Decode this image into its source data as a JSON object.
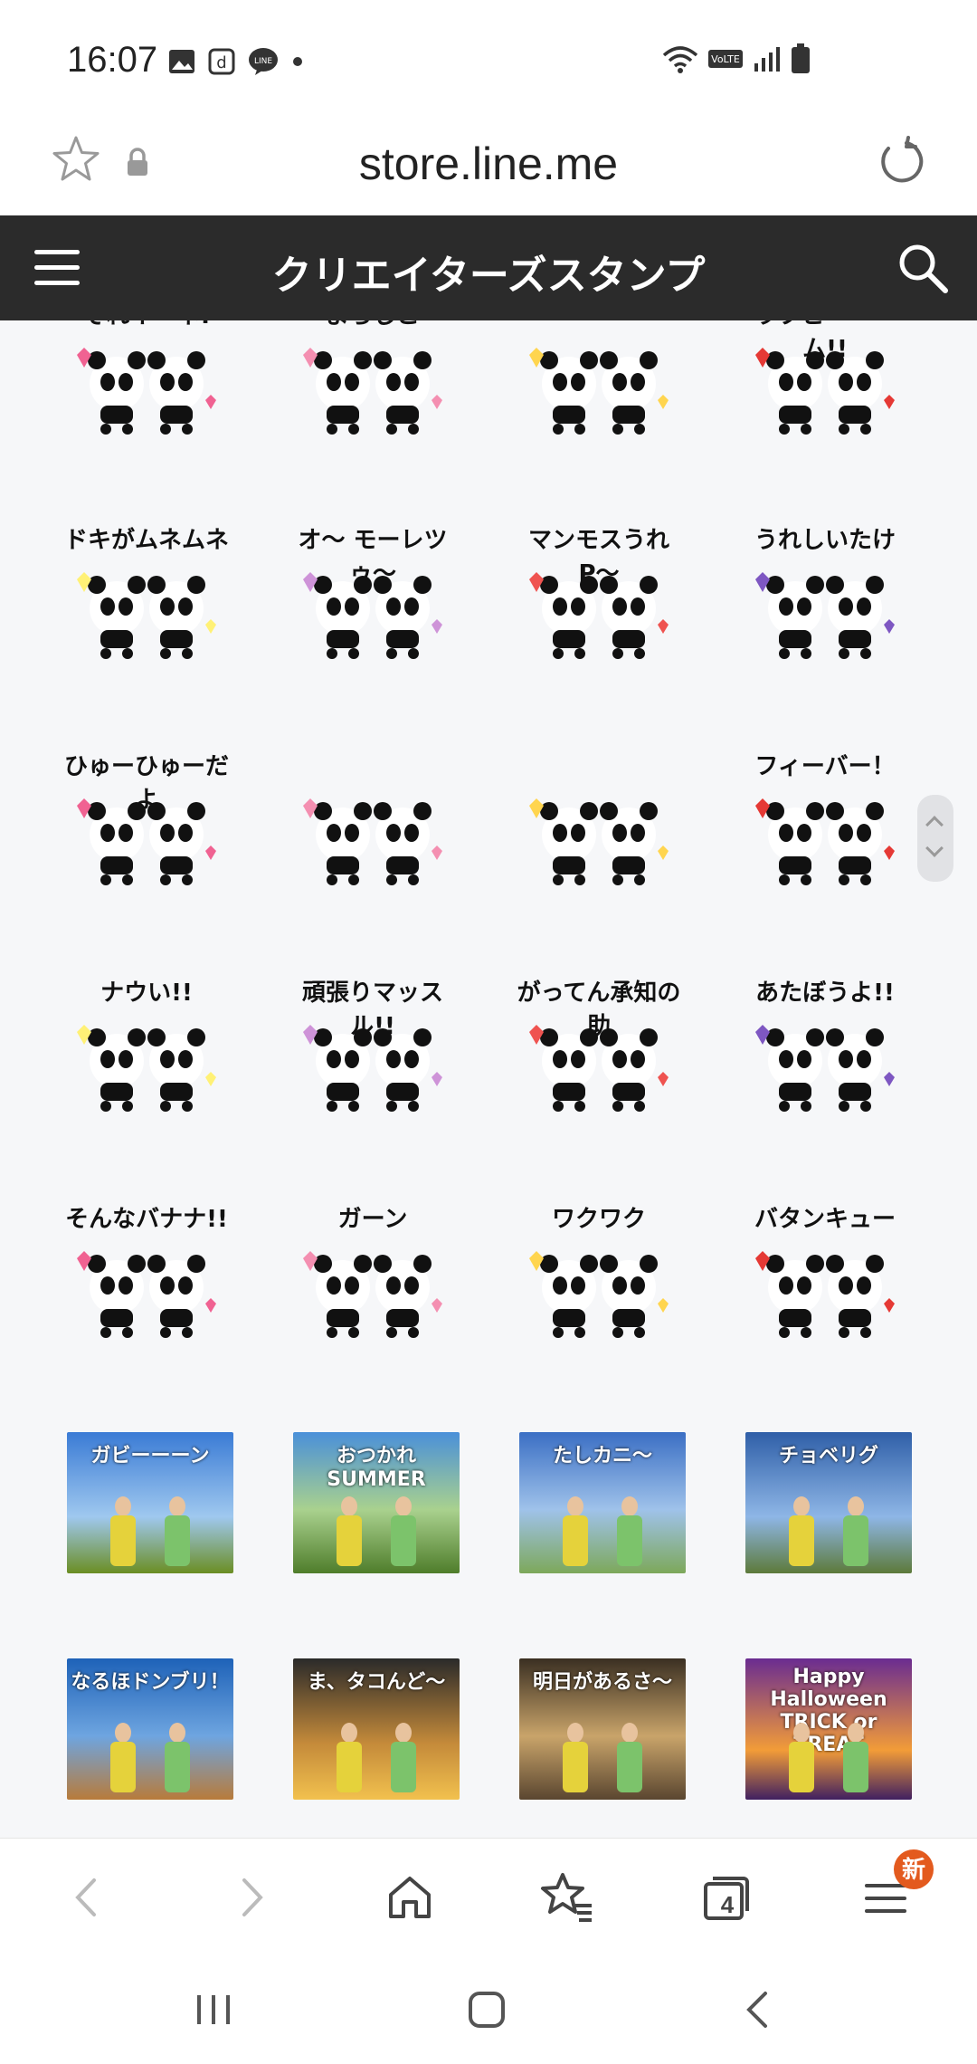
{
  "status_bar": {
    "time": "16:07",
    "left_icons": [
      "gallery-icon",
      "d-app-icon",
      "line-icon",
      "dot-icon"
    ],
    "right_icons": [
      "wifi-icon",
      "volte-icon",
      "signal-icon",
      "battery-icon"
    ]
  },
  "address_bar": {
    "url": "store.line.me",
    "icons": [
      "star-icon",
      "lock-icon",
      "reload-icon"
    ]
  },
  "header": {
    "title": "クリエイターズスタンプ",
    "icons": [
      "menu-icon",
      "search-icon"
    ]
  },
  "stickers": {
    "rows": [
      [
        "それイーネ!",
        "よろしこ",
        "",
        "ラブビーーーム!!"
      ],
      [
        "ドキがムネムネ",
        "オ〜 モーレツゥ〜",
        "マンモスうれP〜",
        "うれしいたけ"
      ],
      [
        "ひゅーひゅーだよ",
        "",
        "",
        "フィーバー！"
      ],
      [
        "ナウい!!",
        "頑張りマッスル!!",
        "がってん承知の助",
        "あたぼうよ!!"
      ],
      [
        "そんなバナナ!!",
        "ガーン",
        "ワクワク",
        "バタンキュー"
      ],
      [
        "ガビーーーン",
        "おつかれ SUMMER",
        "たしカニ〜",
        "チョベリグ"
      ],
      [
        "なるほドンブリ！",
        "ま、タコんど〜",
        "明日があるさ〜",
        "Happy Halloween TRICK or TREAT"
      ]
    ]
  },
  "bottom_nav": {
    "icons": [
      "back-icon",
      "forward-icon",
      "home-icon",
      "bookmarks-icon",
      "tabs-icon",
      "menu-icon"
    ],
    "tabs_count": "4",
    "badge": "新"
  },
  "system_nav": {
    "icons": [
      "recents-icon",
      "home-icon",
      "back-icon"
    ]
  },
  "colors": {
    "header_bg": "#2b2b2b",
    "content_bg": "#f6f7f9",
    "badge": "#e35a1e"
  }
}
